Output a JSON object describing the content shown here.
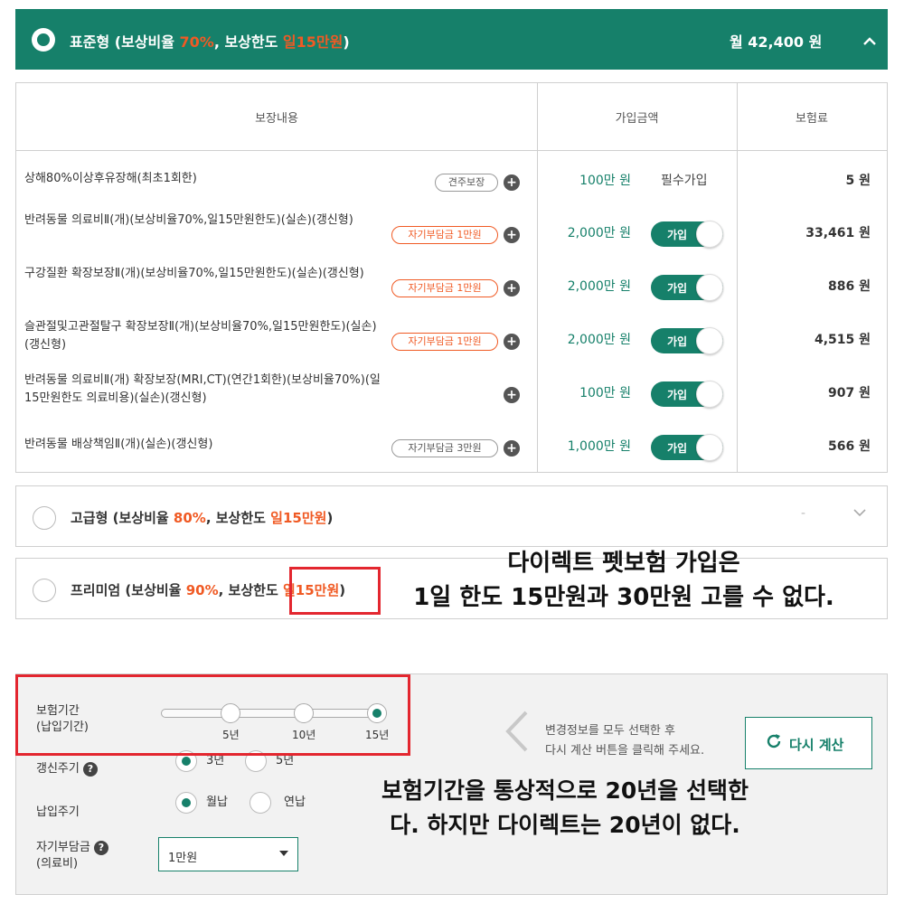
{
  "colors": {
    "brand": "#16806a",
    "accent": "#f05a24",
    "highlight_box": "#e3262f"
  },
  "plan_standard": {
    "name": "표준형",
    "title_prefix": "(보상비율 ",
    "ratio": "70%",
    "title_mid": ", 보상한도 ",
    "limit": "일15만원",
    "title_suffix": ")",
    "price": "월 42,400 원",
    "expand_icon": "chevron-up-icon"
  },
  "table": {
    "headers": {
      "coverage": "보장내용",
      "amount": "가입금액",
      "premium": "보험료"
    },
    "rows": [
      {
        "name": "상해80%이상후유장해(최초1회한)",
        "badge": "견주보장",
        "badge_style": "gray",
        "amount": "100만 원",
        "status": "필수가입",
        "premium": "5 원"
      },
      {
        "name": "반려동물 의료비Ⅱ(개)(보상비율70%,일15만원한도)(실손)(갱신형)",
        "badge": "자기부담금 1만원",
        "badge_style": "orange",
        "amount": "2,000만 원",
        "toggle": "가입",
        "premium": "33,461 원"
      },
      {
        "name": "구강질환 확장보장Ⅱ(개)(보상비율70%,일15만원한도)(실손)(갱신형)",
        "badge": "자기부담금 1만원",
        "badge_style": "orange",
        "amount": "2,000만 원",
        "toggle": "가입",
        "premium": "886 원"
      },
      {
        "name": "슬관절및고관절탈구 확장보장Ⅱ(개)(보상비율70%,일15만원한도)(실손)(갱신형)",
        "badge": "자기부담금 1만원",
        "badge_style": "orange",
        "amount": "2,000만 원",
        "toggle": "가입",
        "premium": "4,515 원"
      },
      {
        "name": "반려동물 의료비Ⅱ(개) 확장보장(MRI,CT)(연간1회한)(보상비율70%)(일15만원한도 의료비용)(실손)(갱신형)",
        "badge": "",
        "badge_style": "",
        "amount": "100만 원",
        "toggle": "가입",
        "premium": "907 원"
      },
      {
        "name": "반려동물 배상책임Ⅱ(개)(실손)(갱신형)",
        "badge": "자기부담금 3만원",
        "badge_style": "gray",
        "amount": "1,000만 원",
        "toggle": "가입",
        "premium": "566 원"
      }
    ]
  },
  "plan_advanced": {
    "name": "고급형",
    "title_prefix": " (보상비율 ",
    "ratio": "80%",
    "title_mid": ", 보상한도 ",
    "limit": "일15만원",
    "title_suffix": ")",
    "price": "-"
  },
  "plan_premium": {
    "name": "프리미엄",
    "title_prefix": " (보상비율 ",
    "ratio": "90%",
    "title_mid": ", 보상한도 ",
    "limit": "일15만원",
    "title_suffix": ")"
  },
  "annotation_top": {
    "line1": "다이렉트 펫보험 가입은",
    "line2": "1일 한도 15만원과 30만원 고를 수 없다."
  },
  "annotation_bottom": {
    "line1": "보험기간을 통상적으로 20년을 선택한",
    "line2": "다. 하지만 다이렉트는 20년이 없다."
  },
  "options": {
    "period_label_1": "보험기간",
    "period_label_2": "(납입기간)",
    "period_ticks": [
      "5년",
      "10년",
      "15년"
    ],
    "period_selected_index": 2,
    "renewal_label": "갱신주기",
    "renewal_options": [
      "3년",
      "5년"
    ],
    "renewal_selected_index": 0,
    "payment_label": "납입주기",
    "payment_options": [
      "월납",
      "연납"
    ],
    "payment_selected_index": 0,
    "deductible_label_1": "자기부담금",
    "deductible_label_2": "(의료비)",
    "deductible_value": "1만원",
    "help_icon_text": "?"
  },
  "recalc": {
    "hint_1": "변경정보를 모두 선택한 후",
    "hint_2": "다시 계산 버튼을 클릭해 주세요.",
    "button_label": "다시 계산",
    "button_icon": "refresh-icon"
  }
}
